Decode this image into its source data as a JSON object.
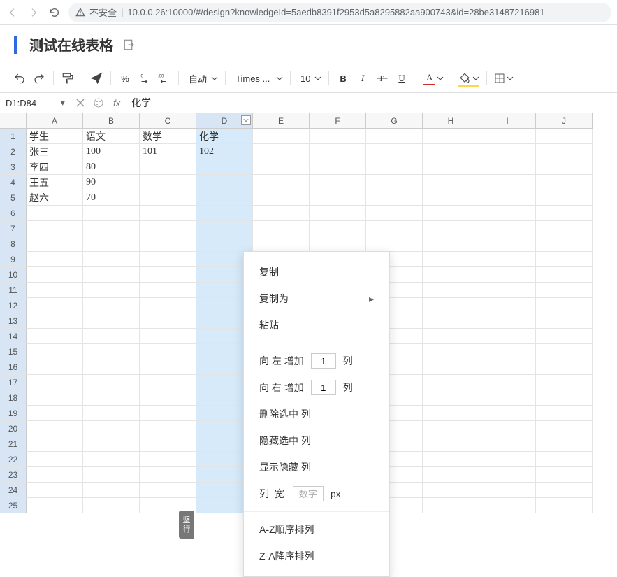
{
  "browser": {
    "insecure_label": "不安全",
    "url": "10.0.0.26:10000/#/design?knowledgeId=5aedb8391f2953d5a8295882aa900743&id=28be31487216981"
  },
  "title": "测试在线表格",
  "toolbar": {
    "auto_label": "自动",
    "font_family": "Times ...",
    "font_size": "10",
    "percent": "%",
    "bold": "B",
    "italic": "I",
    "underline": "U",
    "text_color_letter": "A"
  },
  "name_box": "D1:D84",
  "fx_label": "fx",
  "formula_value": "化学",
  "columns": [
    "A",
    "B",
    "C",
    "D",
    "E",
    "F",
    "G",
    "H",
    "I",
    "J"
  ],
  "selected_col_index": 3,
  "row_count": 25,
  "grid": {
    "r1": {
      "A": "学生",
      "B": "语文",
      "C": "数学",
      "D": "化学"
    },
    "r2": {
      "A": "张三",
      "B": "100",
      "C": "101",
      "D": "102"
    },
    "r3": {
      "A": "李四",
      "B": "80"
    },
    "r4": {
      "A": "王五",
      "B": "90"
    },
    "r5": {
      "A": "赵六",
      "B": "70"
    }
  },
  "float_tab": {
    "l1": "坚",
    "l2": "行"
  },
  "context_menu": {
    "copy": "复制",
    "copy_as": "复制为",
    "paste": "粘贴",
    "insert_left_pre": "向 左 增加",
    "insert_left_val": "1",
    "insert_right_pre": "向 右 增加",
    "insert_right_val": "1",
    "col_suffix": "列",
    "delete_sel": "删除选中 列",
    "hide_sel": "隐藏选中 列",
    "show_hidden": "显示隐藏 列",
    "col_width_label": "列 宽",
    "col_width_placeholder": "数字",
    "px": "px",
    "sort_az": "A-Z顺序排列",
    "sort_za": "Z-A降序排列"
  }
}
